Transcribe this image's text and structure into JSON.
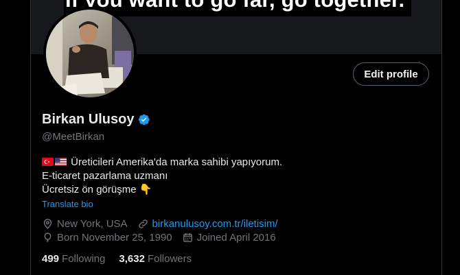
{
  "banner": {
    "quote": "If you want to go far, go together.”"
  },
  "profile": {
    "name": "Birkan Ulusoy",
    "handle": "@MeetBirkan",
    "edit_label": "Edit profile",
    "bio": {
      "line1": "Üreticileri Amerika'da marka sahibi yapıyorum.",
      "line2": "E-ticaret pazarlama uzmanı",
      "line3": "Ücretsiz ön görüşme 👇"
    },
    "translate_label": "Translate bio",
    "location": "New York, USA",
    "website": "birkanulusoy.com.tr/iletisim/",
    "born": "Born November 25, 1990",
    "joined": "Joined April 2016",
    "following_count": "499",
    "following_label": "Following",
    "followers_count": "3,632",
    "followers_label": "Followers"
  },
  "icons": {
    "verified": "verified-badge-icon",
    "location": "location-pin-icon",
    "link": "link-icon",
    "birthday": "balloon-icon",
    "calendar": "calendar-icon"
  },
  "colors": {
    "accent": "#1d9bf0",
    "muted": "#71767b",
    "text": "#e7e9ea",
    "bg": "#000000"
  }
}
